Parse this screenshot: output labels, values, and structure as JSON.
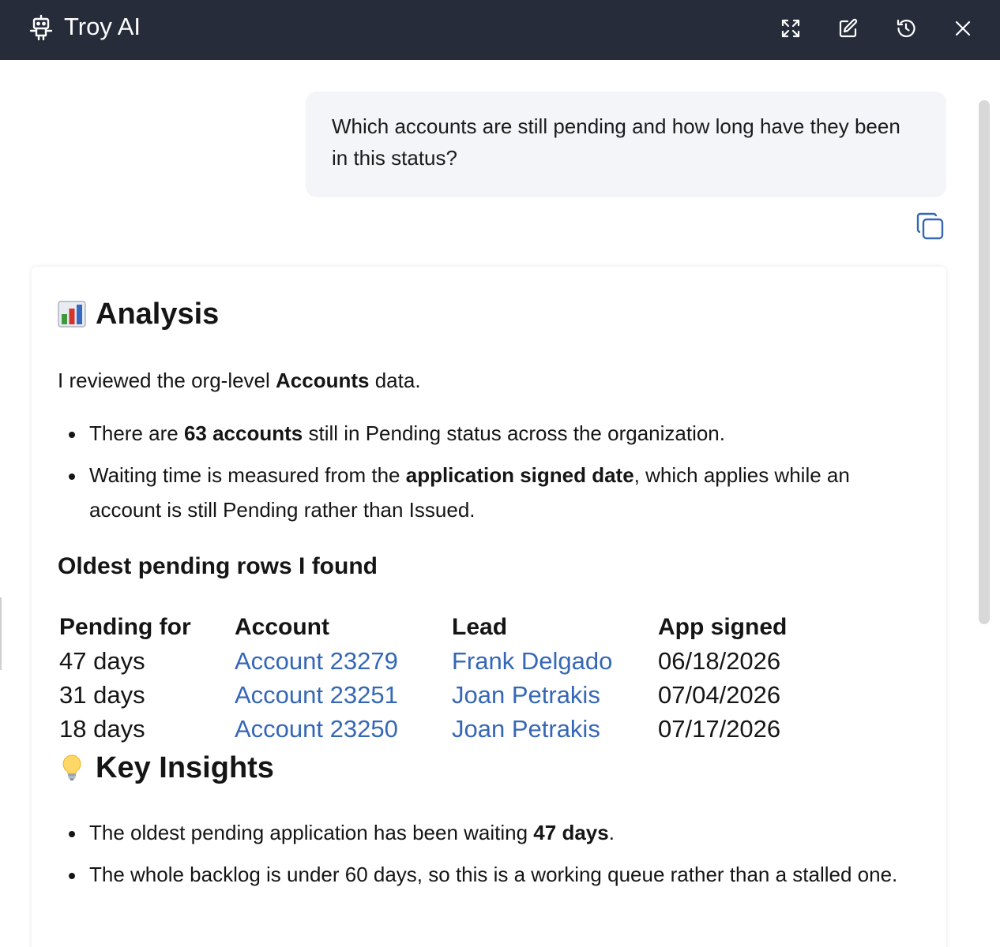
{
  "header": {
    "title": "Troy AI",
    "icons": [
      "robot-icon",
      "expand-icon",
      "edit-icon",
      "history-icon",
      "close-icon"
    ]
  },
  "user_message": {
    "text": "Which accounts are still pending and how long have they been in this status?"
  },
  "answer": {
    "analysis": {
      "emoji": "bar-chart-emoji",
      "title": "Analysis",
      "intro_pre": "I reviewed the org-level ",
      "intro_bold": "Accounts",
      "intro_post": " data.",
      "bullet1_pre": "There are ",
      "bullet1_bold": "63 accounts",
      "bullet1_post": " still in Pending status across the organization.",
      "bullet2_pre": "Waiting time is measured from the ",
      "bullet2_bold": "application signed date",
      "bullet2_post": ", which applies while an account is still Pending rather than Issued."
    },
    "oldest_title": "Oldest pending rows I found",
    "table": {
      "headers": [
        "Pending for",
        "Account",
        "Lead",
        "App signed"
      ],
      "rows": [
        [
          "47 days",
          "Account 23279",
          "Frank Delgado",
          "06/18/2026"
        ],
        [
          "31 days",
          "Account 23251",
          "Joan Petrakis",
          "07/04/2026"
        ],
        [
          "18 days",
          "Account 23250",
          "Joan Petrakis",
          "07/17/2026"
        ]
      ]
    },
    "insights": {
      "emoji": "lightbulb-emoji",
      "title": "Key Insights",
      "bullet1_pre": "The oldest pending application has been waiting ",
      "bullet1_bold": "47 days",
      "bullet1_post": ".",
      "bullet2": "The whole backlog is under 60 days, so this is a working queue rather than a stalled one."
    }
  },
  "colors": {
    "header_bg": "#262c3a",
    "link": "#3567b6",
    "user_bubble_bg": "#f4f5f9"
  }
}
